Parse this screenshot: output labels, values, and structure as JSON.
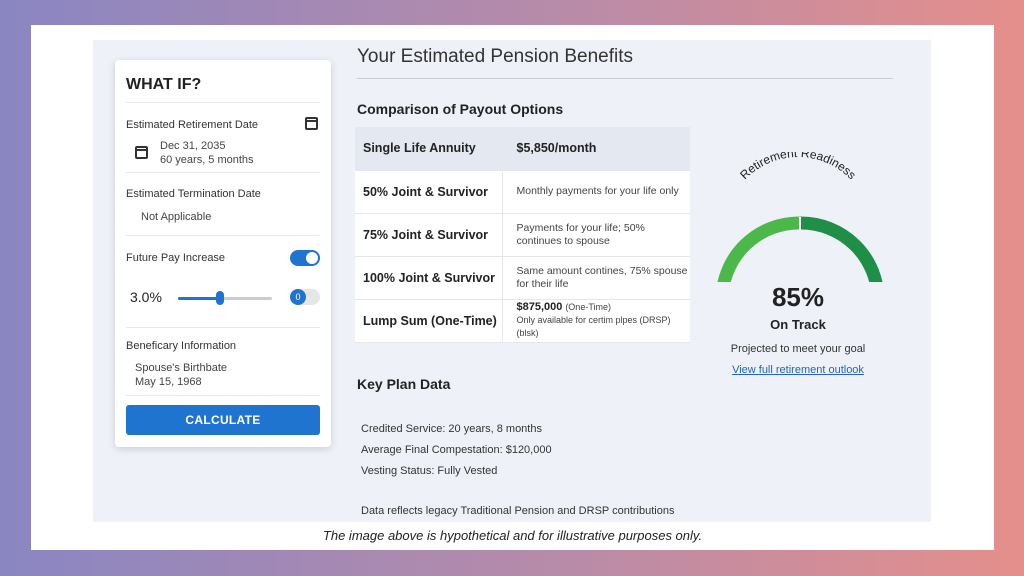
{
  "whatif": {
    "title": "WHAT IF?",
    "retirement_label": "Estimated Retirement Date",
    "retirement_date": "Dec 31, 2035",
    "retirement_age": "60 years, 5 months",
    "termination_label": "Estimated Termination Date",
    "termination_value": "Not Applicable",
    "pay_increase_label": "Future Pay Increase",
    "pay_increase_enabled": true,
    "pay_increase_value": "3.0%",
    "pay_increase_slider": 0.45,
    "small_toggle_text": "0",
    "beneficiary_label": "Beneficary Information",
    "spouse_label": "Spouse's Birthbate",
    "spouse_date": "May 15, 1968",
    "calculate_label": "CALCULATE",
    "icons": [
      "calendar-icon",
      "calendar-icon"
    ]
  },
  "main": {
    "title": "Your Estimated Pension Benefits",
    "comparison_title": "Comparison of Payout Options",
    "payout_options": [
      {
        "name": "Single Life Annuity",
        "desc": "$5,850/month"
      },
      {
        "name": "50% Joint & Survivor",
        "desc": "Monthly payments for your life only"
      },
      {
        "name": "75% Joint & Survivor",
        "desc": "Payments for your life; 50% continues to spouse"
      },
      {
        "name": "100% Joint & Survivor",
        "desc": "Same amount contines, 75% spouse for their life"
      },
      {
        "name": "Lump Sum (One-Time)",
        "desc_amount": "$875,000",
        "desc_note": "(One-Time)",
        "desc_extra": "Only available for certim plpes (DRSP) (blsk)"
      }
    ],
    "key_plan_title": "Key Plan Data",
    "key_plan": [
      "Credited Service: 20 years, 8 months",
      "Average Final Compestation: $120,000",
      "Vesting Status: Fully Vested"
    ],
    "footnote": "Data reflects legacy Traditional Pension and DRSP contributions"
  },
  "gauge": {
    "title": "Retirement Readiness",
    "percent": "85%",
    "percent_value": 85,
    "status": "On Track",
    "projection": "Projected to meet your goal",
    "link": "View full retirement outlook",
    "colors": {
      "light": "#4cb84a",
      "dark": "#1f8f48"
    }
  },
  "caption": "The image above is hypothetical and for illustrative purposes only."
}
